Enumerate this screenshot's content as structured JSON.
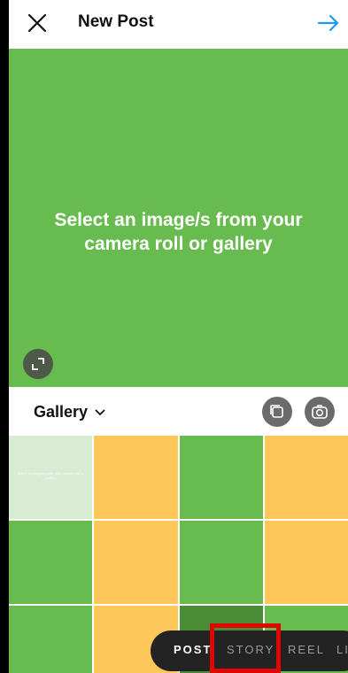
{
  "header": {
    "title": "New Post",
    "close_icon": "close-icon",
    "next_icon": "arrow-right-icon",
    "accent": "#2196f3"
  },
  "preview": {
    "message": "Select an image/s from your camera roll or gallery",
    "background": "#68bb4e",
    "expand_icon": "expand-icon"
  },
  "gallery": {
    "label": "Gallery",
    "dropdown_icon": "chevron-down-icon",
    "multi_select_icon": "multi-select-icon",
    "camera_icon": "camera-icon",
    "thumb_text": "Select an image/s from your camera roll or gallery"
  },
  "modes": {
    "items": [
      "POST",
      "STORY",
      "REEL",
      "LIV"
    ],
    "active": "POST"
  },
  "colors": {
    "green": "#68bb4e",
    "yellow": "#fec75a",
    "highlight": "#e10600"
  }
}
